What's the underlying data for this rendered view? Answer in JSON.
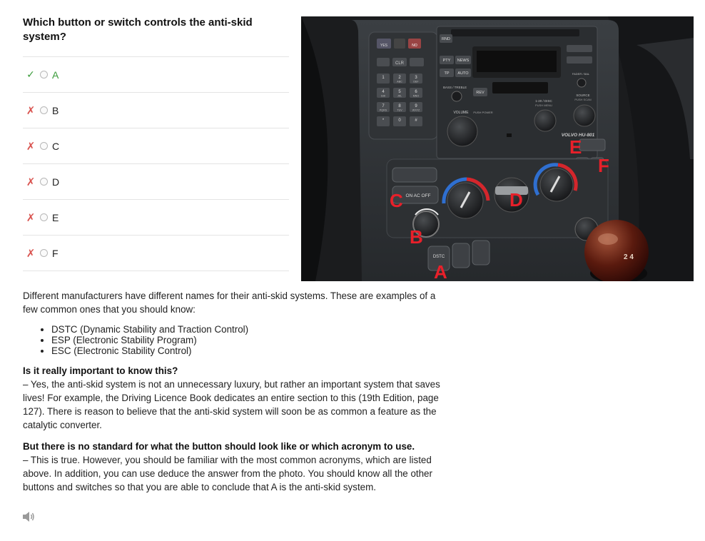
{
  "question": "Which button or switch controls the anti-skid system?",
  "options": [
    {
      "label": "A",
      "mark": "✓",
      "status": "correct"
    },
    {
      "label": "B",
      "mark": "✗",
      "status": "wrong"
    },
    {
      "label": "C",
      "mark": "✗",
      "status": "wrong"
    },
    {
      "label": "D",
      "mark": "✗",
      "status": "wrong"
    },
    {
      "label": "E",
      "mark": "✗",
      "status": "wrong"
    },
    {
      "label": "F",
      "mark": "✗",
      "status": "wrong"
    }
  ],
  "photo": {
    "markers": {
      "a": "A",
      "b": "B",
      "c": "C",
      "d": "D",
      "e": "E",
      "f": "F"
    },
    "texts": {
      "yes": "YES",
      "no": "NO",
      "clr": "CLR",
      "rnd": "RND",
      "pty": "PTY",
      "news": "NEWS",
      "tp": "TP",
      "auto": "AUTO",
      "bass": "BASS / TREBLE",
      "rev": "REV",
      "volume": "VOLUME",
      "push_power": "PUSH POWER",
      "disc": "1-20 / DISC",
      "push_menu": "PUSH MENU",
      "source": "SOURCE",
      "push_scan": "PUSH SCAN",
      "fader": "FADER / BAL",
      "brand": "VOLVO HU-801",
      "on_ac_off": "ON  AC  OFF",
      "dstc": "DSTC",
      "keys": [
        "1",
        "2",
        "3",
        "4",
        "5",
        "6",
        "7",
        "8",
        "9",
        "*",
        "0",
        "#"
      ],
      "key_subs": [
        "",
        "ABC",
        "DEF",
        "GHI",
        "JKL",
        "MNO",
        "PQRS",
        "TUV",
        "WXYZ",
        "",
        "",
        ""
      ]
    },
    "colors": {
      "marker": "#e8202a",
      "hot": "#d4262c",
      "cold": "#2f6fd0",
      "wood": "#5a1a0e"
    }
  },
  "explanation": {
    "intro": "Different manufacturers have different names for their anti-skid systems. These are examples of a few common ones that you should know:",
    "bullets": [
      "DSTC (Dynamic Stability and Traction Control)",
      "ESP (Electronic Stability Program)",
      "ESC (Electronic Stability Control)"
    ],
    "q1_heading": "Is it really important to know this?",
    "q1_body": "– Yes, the anti-skid system is not an unnecessary luxury, but rather an important system that saves lives! For example, the Driving Licence Book dedicates an entire section to this (19th Edition, page 127). There is reason to believe that the anti-skid system will soon be as common a feature as the catalytic converter.",
    "q2_heading": "But there is no standard for what the button should look like or which acronym to use.",
    "q2_body": "– This is true. However, you should be familiar with the most common acronyms, which are listed above. In addition, you can use deduce the answer from the photo. You should know all the other buttons and switches so that you are able to conclude that A is the anti-skid system."
  },
  "speaker_icon": "speaker-icon"
}
